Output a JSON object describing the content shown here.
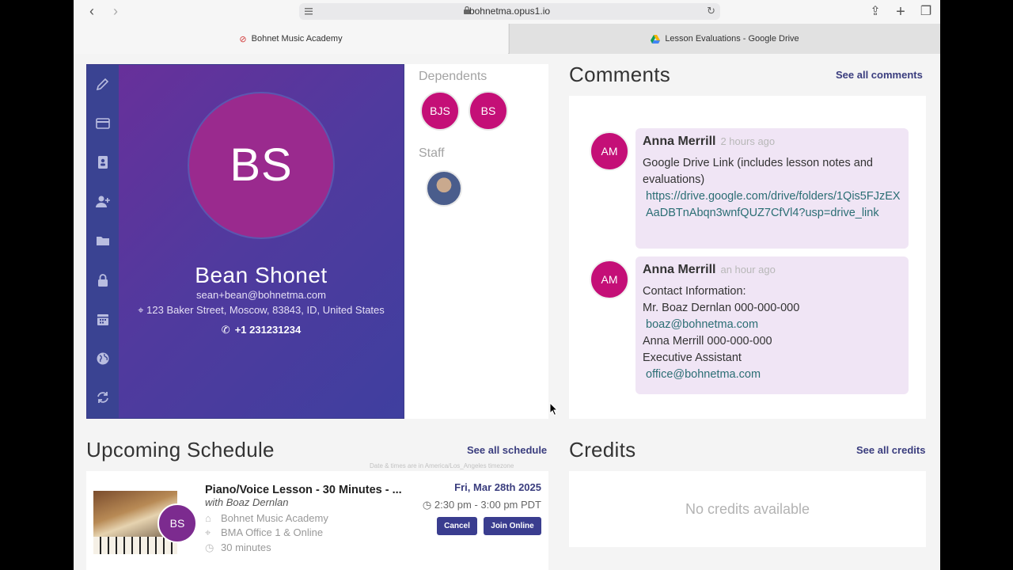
{
  "browser": {
    "url": "bohnetma.opus1.io",
    "tabs": [
      {
        "label": "Bohnet Music Academy",
        "active": true
      },
      {
        "label": "Lesson Evaluations - Google Drive",
        "active": false
      }
    ]
  },
  "profile": {
    "initials": "BS",
    "name": "Bean Shonet",
    "email": "sean+bean@bohnetma.com",
    "address": "123 Baker Street, Moscow, 83843, ID, United States",
    "phone": "+1 231231234"
  },
  "dependents": {
    "label": "Dependents",
    "items": [
      "BJS",
      "BS"
    ]
  },
  "staff": {
    "label": "Staff"
  },
  "comments": {
    "title": "Comments",
    "see_all": "See all comments",
    "items": [
      {
        "initials": "AM",
        "author": "Anna Merrill",
        "ago": "2 hours ago",
        "text": "Google Drive Link (includes lesson notes and evaluations)",
        "link": "https://drive.google.com/drive/folders/1Qis5FJzEXAaDBTnAbqn3wnfQUZ7CfVl4?usp=drive_link"
      },
      {
        "initials": "AM",
        "author": "Anna Merrill",
        "ago": "an hour ago",
        "line1": "Contact Information:",
        "line2": "Mr. Boaz Dernlan 000-000-000",
        "link1": "boaz@bohnetma.com",
        "line3": "Anna Merrill 000-000-000",
        "line4": "Executive Assistant",
        "link2": "office@bohnetma.com"
      }
    ]
  },
  "schedule": {
    "title": "Upcoming Schedule",
    "see_all": "See all schedule",
    "tz_note": "Date & times are in America/Los_Angeles timezone",
    "lesson": {
      "title": "Piano/Voice Lesson - 30 Minutes - ...",
      "with": "with Boaz Dernlan",
      "initials": "BS",
      "academy": "Bohnet Music Academy",
      "location": "BMA Office 1 & Online",
      "duration": "30 minutes",
      "date": "Fri, Mar 28th 2025",
      "time": "2:30 pm - 3:00 pm PDT",
      "cancel_label": "Cancel",
      "join_label": "Join Online"
    }
  },
  "credits": {
    "title": "Credits",
    "see_all": "See all credits",
    "empty": "No credits available"
  },
  "colors": {
    "brand": "#3a3d8f",
    "avatar": "#c40f77",
    "link": "#2b6e74"
  }
}
